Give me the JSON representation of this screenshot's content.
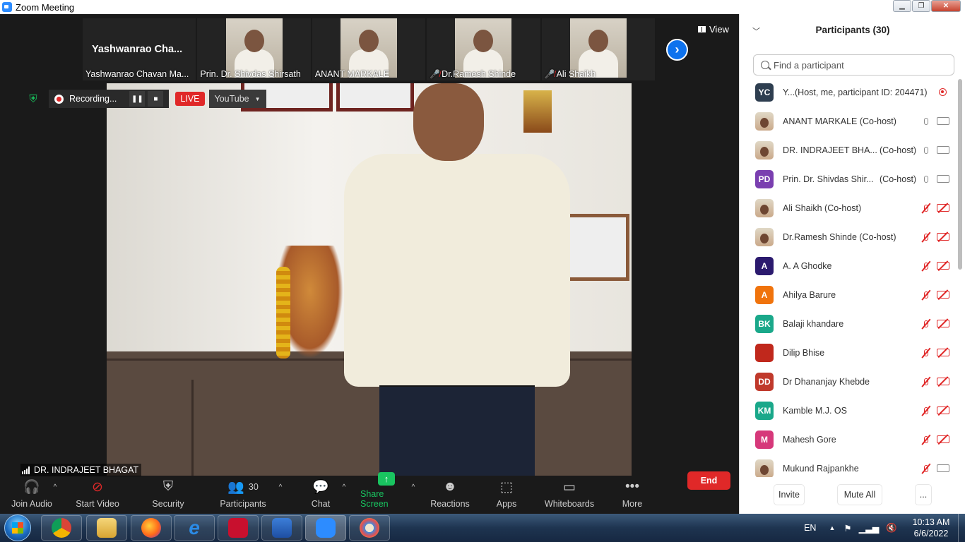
{
  "window": {
    "title": "Zoom Meeting"
  },
  "thumbnails": [
    {
      "name": "Yashwanrao Chavan Ma...",
      "big_label": "Yashwanrao  Cha...",
      "muted": false,
      "photo": false
    },
    {
      "name": "Prin. Dr. Shivdas Shirsath",
      "muted": false,
      "photo": true
    },
    {
      "name": "ANANT MARKALE",
      "muted": false,
      "photo": true
    },
    {
      "name": "Dr.Ramesh Shinde",
      "muted": true,
      "photo": true
    },
    {
      "name": "Ali Shaikh",
      "muted": true,
      "photo": true
    }
  ],
  "view_label": "View",
  "recording": {
    "label": "Recording...",
    "live": "LIVE",
    "stream": "YouTube"
  },
  "active_speaker": "DR. INDRAJEET BHAGAT",
  "toolbar": {
    "join_audio": "Join Audio",
    "start_video": "Start Video",
    "security": "Security",
    "participants": "Participants",
    "participants_count": "30",
    "chat": "Chat",
    "share_screen": "Share Screen",
    "reactions": "Reactions",
    "apps": "Apps",
    "whiteboards": "Whiteboards",
    "more": "More",
    "end": "End"
  },
  "panel": {
    "title": "Participants (30)",
    "search_placeholder": "Find a participant",
    "invite": "Invite",
    "mute_all": "Mute All",
    "more": "..."
  },
  "participants": [
    {
      "initials": "YC",
      "color": "#2e3e50",
      "name": "Y...",
      "role": "(Host, me, participant ID: 204471)",
      "audio": "none",
      "video": "rec"
    },
    {
      "initials": "",
      "color": "",
      "name": "ANANT MARKALE (Co-host)",
      "role": "",
      "audio": "on",
      "video": "on",
      "photo": true
    },
    {
      "initials": "",
      "color": "",
      "name": "DR. INDRAJEET BHA...",
      "role": "(Co-host)",
      "audio": "on",
      "video": "on",
      "photo": true
    },
    {
      "initials": "PD",
      "color": "#7a3fb0",
      "name": "Prin. Dr. Shivdas Shir...",
      "role": "(Co-host)",
      "audio": "on",
      "video": "on"
    },
    {
      "initials": "",
      "color": "",
      "name": "Ali Shaikh (Co-host)",
      "role": "",
      "audio": "muted",
      "video": "muted",
      "photo": true
    },
    {
      "initials": "",
      "color": "",
      "name": "Dr.Ramesh Shinde (Co-host)",
      "role": "",
      "audio": "muted",
      "video": "muted",
      "photo": true
    },
    {
      "initials": "A",
      "color": "#2b1a6e",
      "name": "A. A Ghodke",
      "role": "",
      "audio": "muted",
      "video": "muted"
    },
    {
      "initials": "A",
      "color": "#f0730c",
      "name": "Ahilya Barure",
      "role": "",
      "audio": "muted",
      "video": "muted"
    },
    {
      "initials": "BK",
      "color": "#1aa88a",
      "name": "Balaji khandare",
      "role": "",
      "audio": "muted",
      "video": "muted"
    },
    {
      "initials": "",
      "color": "#c0281c",
      "name": "Dilip Bhise",
      "role": "",
      "audio": "muted",
      "video": "muted"
    },
    {
      "initials": "DD",
      "color": "#c0392b",
      "name": "Dr Dhananjay Khebde",
      "role": "",
      "audio": "muted",
      "video": "muted"
    },
    {
      "initials": "KM",
      "color": "#1aa88a",
      "name": "Kamble M.J. OS",
      "role": "",
      "audio": "muted",
      "video": "muted"
    },
    {
      "initials": "M",
      "color": "#d6387a",
      "name": "Mahesh Gore",
      "role": "",
      "audio": "muted",
      "video": "muted"
    },
    {
      "initials": "",
      "color": "",
      "name": "Mukund Rajpankhe",
      "role": "",
      "audio": "muted",
      "video": "on",
      "photo": true
    }
  ],
  "taskbar": {
    "lang": "EN",
    "time": "10:13 AM",
    "date": "6/6/2022"
  }
}
